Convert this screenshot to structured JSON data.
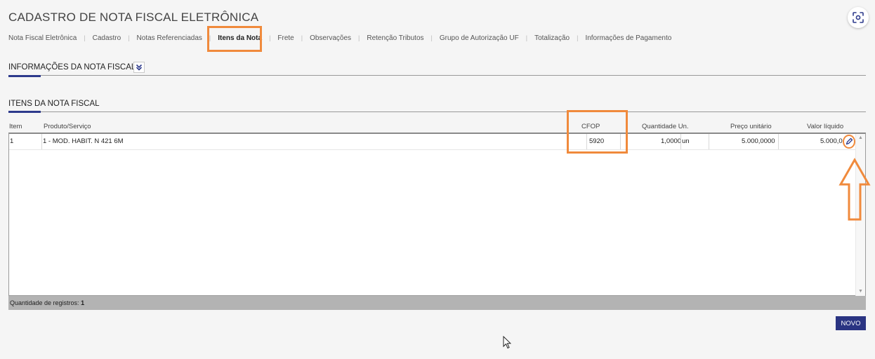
{
  "page": {
    "title": "CADASTRO DE NOTA FISCAL ELETRÔNICA"
  },
  "tabs": [
    {
      "label": "Nota Fiscal Eletrônica",
      "active": false
    },
    {
      "label": "Cadastro",
      "active": false
    },
    {
      "label": "Notas Referenciadas",
      "active": false
    },
    {
      "label": "Itens da Nota",
      "active": true
    },
    {
      "label": "Frete",
      "active": false
    },
    {
      "label": "Observações",
      "active": false
    },
    {
      "label": "Retenção Tributos",
      "active": false
    },
    {
      "label": "Grupo de Autorização UF",
      "active": false
    },
    {
      "label": "Totalização",
      "active": false
    },
    {
      "label": "Informações de Pagamento",
      "active": false
    }
  ],
  "sections": {
    "info": {
      "title": "INFORMAÇÕES DA NOTA FISCAL",
      "expand_icon": "double-chevron-down-icon"
    },
    "items": {
      "title": "ITENS DA NOTA FISCAL"
    }
  },
  "grid": {
    "columns": {
      "item": "Item",
      "produto": "Produto/Serviço",
      "cfop": "CFOP",
      "quantidade": "Quantidade Un.",
      "preco": "Preço unitário",
      "valor": "Valor líquido"
    },
    "rows": [
      {
        "item": "1",
        "produto": "1 - MOD. HABIT. N 421 6M",
        "cfop": "5920",
        "quantidade": "1,0000",
        "unidade": "un",
        "preco": "5.000,0000",
        "valor": "5.000,0"
      }
    ],
    "footer": {
      "label": "Quantidade de registros:",
      "count": "1"
    }
  },
  "actions": {
    "novo_label": "NOVO"
  },
  "icons": {
    "screenshot": "screenshot-scan-icon",
    "edit": "pencil-edit-icon",
    "annotation_arrow": "arrow-up-outline-icon",
    "cursor": "mouse-pointer-icon"
  },
  "colors": {
    "accent": "#2a3482",
    "annotation": "#f08a3c",
    "status_bar": "#b3b3b3"
  }
}
